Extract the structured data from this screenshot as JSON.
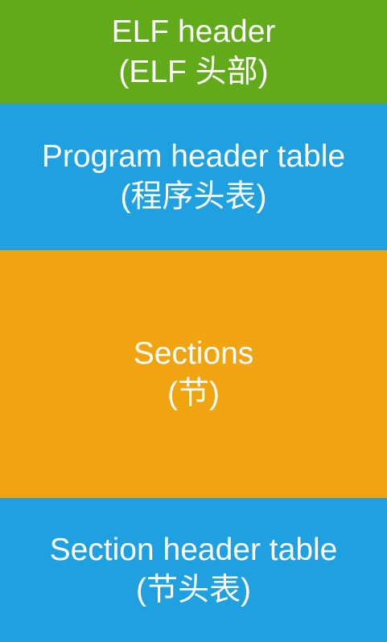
{
  "blocks": [
    {
      "title": "ELF header",
      "subtitle": "(ELF 头部)",
      "color": "#61AB1B"
    },
    {
      "title": "Program header table",
      "subtitle": "(程序头表)",
      "color": "#1FA1E1"
    },
    {
      "title": "Sections",
      "subtitle": "(节)",
      "color": "#EFA410"
    },
    {
      "title": "Section header table",
      "subtitle": "(节头表)",
      "color": "#1FA1E1"
    }
  ]
}
